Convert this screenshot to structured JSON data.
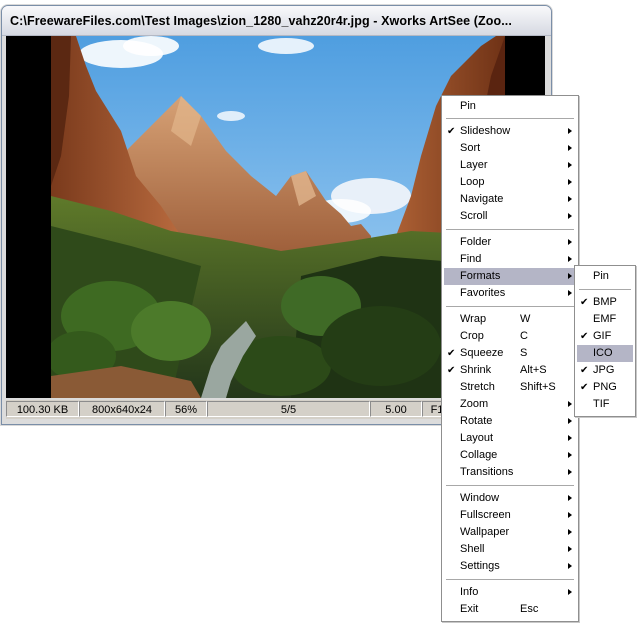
{
  "window": {
    "title": "C:\\FreewareFiles.com\\Test Images\\zion_1280_vahz20r4r.jpg - Xworks ArtSee (Zoo..."
  },
  "status": {
    "filesize": "100.30 KB",
    "dimensions": "800x640x24",
    "zoom": "56%",
    "position": "5/5",
    "interval": "5.00",
    "key": "F1"
  },
  "context_menu": {
    "items": [
      {
        "label": "Pin"
      },
      {
        "label": "Slideshow",
        "checked": true,
        "submenu": true
      },
      {
        "label": "Sort",
        "submenu": true
      },
      {
        "label": "Layer",
        "submenu": true
      },
      {
        "label": "Loop",
        "submenu": true
      },
      {
        "label": "Navigate",
        "submenu": true
      },
      {
        "label": "Scroll",
        "submenu": true
      },
      {
        "label": "Folder",
        "submenu": true
      },
      {
        "label": "Find",
        "submenu": true
      },
      {
        "label": "Formats",
        "submenu": true,
        "highlighted": true
      },
      {
        "label": "Favorites",
        "submenu": true
      },
      {
        "label": "Wrap",
        "shortcut": "W"
      },
      {
        "label": "Crop",
        "shortcut": "C"
      },
      {
        "label": "Squeeze",
        "shortcut": "S",
        "checked": true
      },
      {
        "label": "Shrink",
        "shortcut": "Alt+S",
        "checked": true
      },
      {
        "label": "Stretch",
        "shortcut": "Shift+S"
      },
      {
        "label": "Zoom",
        "submenu": true
      },
      {
        "label": "Rotate",
        "submenu": true
      },
      {
        "label": "Layout",
        "submenu": true
      },
      {
        "label": "Collage",
        "submenu": true
      },
      {
        "label": "Transitions",
        "submenu": true
      },
      {
        "label": "Window",
        "submenu": true
      },
      {
        "label": "Fullscreen",
        "submenu": true
      },
      {
        "label": "Wallpaper",
        "submenu": true
      },
      {
        "label": "Shell",
        "submenu": true
      },
      {
        "label": "Settings",
        "submenu": true
      },
      {
        "label": "Info",
        "submenu": true
      },
      {
        "label": "Exit",
        "shortcut": "Esc"
      }
    ]
  },
  "formats_menu": {
    "items": [
      {
        "label": "Pin"
      },
      {
        "label": "BMP",
        "checked": true
      },
      {
        "label": "EMF"
      },
      {
        "label": "GIF",
        "checked": true
      },
      {
        "label": "ICO",
        "highlighted": true
      },
      {
        "label": "JPG",
        "checked": true
      },
      {
        "label": "PNG",
        "checked": true
      },
      {
        "label": "TIF"
      }
    ]
  },
  "colors": {
    "menu_highlight": "#b4b5c6",
    "title_bar": "#e4e6ec",
    "status_bar": "#d4d0c8"
  }
}
